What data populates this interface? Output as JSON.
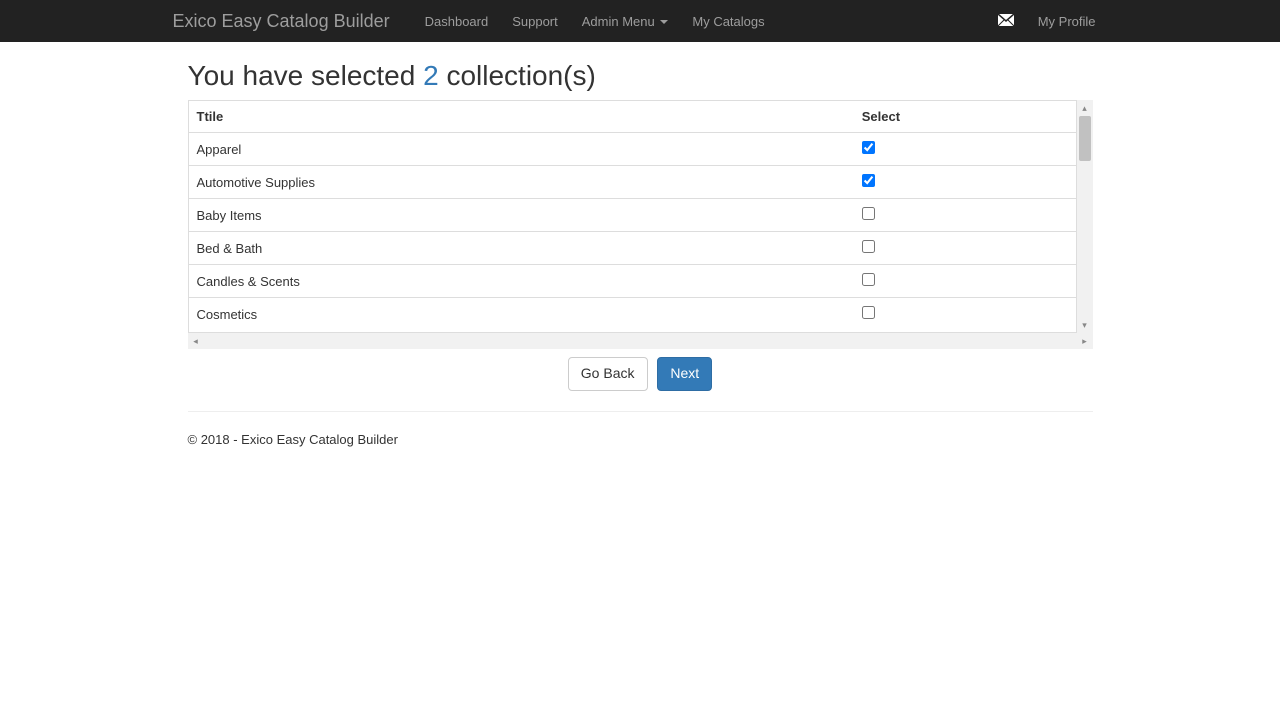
{
  "navbar": {
    "brand": "Exico Easy Catalog Builder",
    "items": [
      {
        "label": "Dashboard"
      },
      {
        "label": "Support"
      },
      {
        "label": "Admin Menu",
        "dropdown": true
      },
      {
        "label": "My Catalogs"
      }
    ],
    "right": [
      {
        "label": "My Profile"
      }
    ]
  },
  "heading": {
    "prefix": "You have selected ",
    "count": "2",
    "suffix": " collection(s)"
  },
  "table": {
    "columns": [
      {
        "label": "Ttile"
      },
      {
        "label": "Select"
      }
    ],
    "rows": [
      {
        "title": "Apparel",
        "selected": true
      },
      {
        "title": "Automotive Supplies",
        "selected": true
      },
      {
        "title": "Baby Items",
        "selected": false
      },
      {
        "title": "Bed & Bath",
        "selected": false
      },
      {
        "title": "Candles & Scents",
        "selected": false
      },
      {
        "title": "Cosmetics",
        "selected": false
      }
    ]
  },
  "buttons": {
    "back": "Go Back",
    "next": "Next"
  },
  "footer": {
    "text": "© 2018 - Exico Easy Catalog Builder"
  }
}
